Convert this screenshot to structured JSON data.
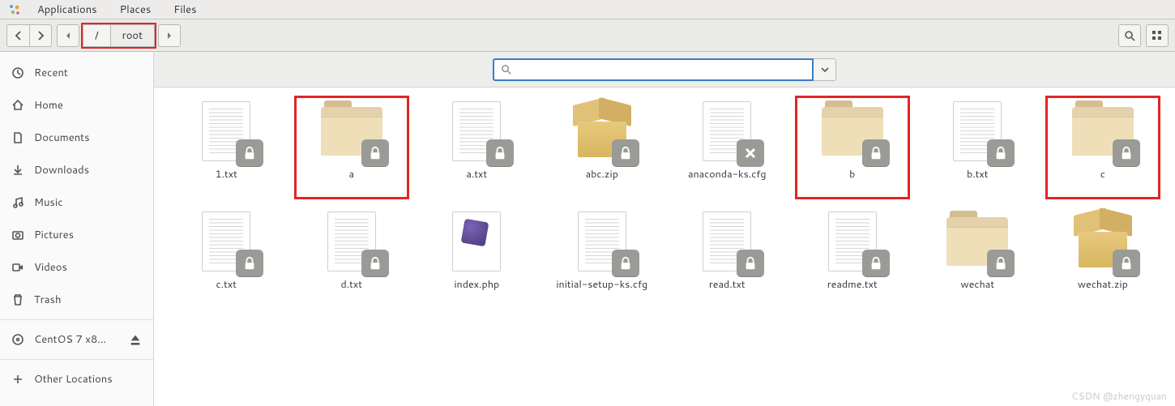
{
  "panel": {
    "menus": [
      "Applications",
      "Places",
      "Files"
    ]
  },
  "toolbar": {
    "path": [
      "/",
      "root"
    ]
  },
  "search": {
    "placeholder": ""
  },
  "sidebar": {
    "items": [
      {
        "icon": "clock",
        "label": "Recent"
      },
      {
        "icon": "home",
        "label": "Home"
      },
      {
        "icon": "doc",
        "label": "Documents"
      },
      {
        "icon": "download",
        "label": "Downloads"
      },
      {
        "icon": "music",
        "label": "Music"
      },
      {
        "icon": "camera",
        "label": "Pictures"
      },
      {
        "icon": "video",
        "label": "Videos"
      },
      {
        "icon": "trash",
        "label": "Trash"
      }
    ],
    "devices": [
      {
        "icon": "disc",
        "label": "CentOS 7 x8…",
        "eject": true
      }
    ],
    "other": {
      "icon": "plus",
      "label": "Other Locations"
    }
  },
  "files": [
    {
      "name": "1.txt",
      "type": "text",
      "badge": "lock",
      "highlight": false
    },
    {
      "name": "a",
      "type": "folder",
      "badge": "lock",
      "highlight": true
    },
    {
      "name": "a.txt",
      "type": "text",
      "badge": "lock",
      "highlight": false
    },
    {
      "name": "abc.zip",
      "type": "zip",
      "badge": "lock",
      "highlight": false
    },
    {
      "name": "anaconda-ks.cfg",
      "type": "text",
      "badge": "x",
      "highlight": false
    },
    {
      "name": "b",
      "type": "folder",
      "badge": "lock",
      "highlight": true
    },
    {
      "name": "b.txt",
      "type": "text",
      "badge": "lock",
      "highlight": false
    },
    {
      "name": "c",
      "type": "folder",
      "badge": "lock",
      "highlight": true
    },
    {
      "name": "c.txt",
      "type": "text",
      "badge": "lock",
      "highlight": false
    },
    {
      "name": "d.txt",
      "type": "text",
      "badge": "lock",
      "highlight": false
    },
    {
      "name": "index.php",
      "type": "php",
      "badge": null,
      "highlight": false
    },
    {
      "name": "initial-setup-ks.cfg",
      "type": "text",
      "badge": "lock",
      "highlight": false
    },
    {
      "name": "read.txt",
      "type": "text",
      "badge": "lock",
      "highlight": false
    },
    {
      "name": "readme.txt",
      "type": "text",
      "badge": "lock",
      "highlight": false
    },
    {
      "name": "wechat",
      "type": "folder",
      "badge": "lock",
      "highlight": false
    },
    {
      "name": "wechat.zip",
      "type": "zip",
      "badge": "lock",
      "highlight": false
    }
  ],
  "watermark": "CSDN @zhengyquan"
}
